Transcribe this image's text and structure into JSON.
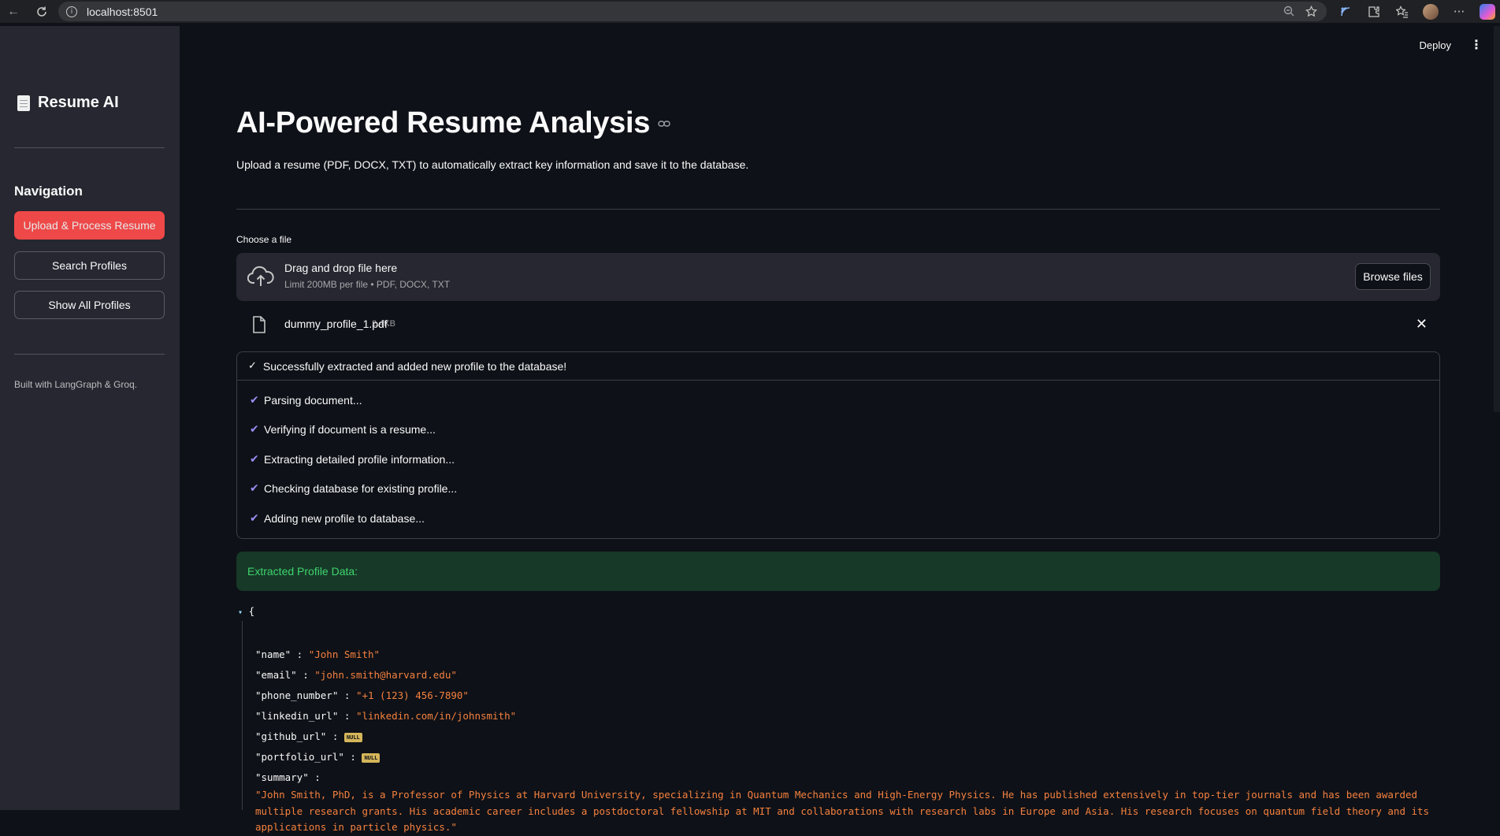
{
  "browser": {
    "url": "localhost:8501"
  },
  "sidebar": {
    "app_title": "Resume AI",
    "nav_heading": "Navigation",
    "buttons": [
      {
        "label": "Upload & Process Resume",
        "active": true
      },
      {
        "label": "Search Profiles",
        "active": false
      },
      {
        "label": "Show All Profiles",
        "active": false
      }
    ],
    "footer": "Built with LangGraph & Groq."
  },
  "header": {
    "deploy_label": "Deploy"
  },
  "main": {
    "title": "AI-Powered Resume Analysis",
    "subtitle": "Upload a resume (PDF, DOCX, TXT) to automatically extract key information and save it to the database.",
    "uploader": {
      "label": "Choose a file",
      "drop_text": "Drag and drop file here",
      "limit_text": "Limit 200MB per file • PDF, DOCX, TXT",
      "browse_label": "Browse files"
    },
    "uploaded_file": {
      "name": "dummy_profile_1.pdf",
      "size": "2.4KB"
    },
    "status": {
      "header": "Successfully extracted and added new profile to the database!",
      "steps": [
        "Parsing document...",
        "Verifying if document is a resume...",
        "Extracting detailed profile information...",
        "Checking database for existing profile...",
        "Adding new profile to database..."
      ]
    },
    "success_message": "Extracted Profile Data:",
    "json": {
      "open_brace": "{",
      "fields": [
        {
          "key": "\"name\"",
          "value": "\"John Smith\"",
          "is_null": false
        },
        {
          "key": "\"email\"",
          "value": "\"john.smith@harvard.edu\"",
          "is_null": false
        },
        {
          "key": "\"phone_number\"",
          "value": "\"+1 (123) 456-7890\"",
          "is_null": false
        },
        {
          "key": "\"linkedin_url\"",
          "value": "\"linkedin.com/in/johnsmith\"",
          "is_null": false
        },
        {
          "key": "\"github_url\"",
          "value": "NULL",
          "is_null": true
        },
        {
          "key": "\"portfolio_url\"",
          "value": "NULL",
          "is_null": true
        }
      ],
      "summary_key": "\"summary\"",
      "summary_value": "\"John Smith, PhD, is a Professor of Physics at Harvard University, specializing in Quantum Mechanics and High-Energy Physics. He has published extensively in top-tier journals and has been awarded multiple research grants. His academic career includes a postdoctoral fellowship at MIT and collaborations with research labs in Europe and Asia. His research focuses on quantum field theory and its applications in particle physics.\""
    }
  },
  "colors": {
    "primary": "#ff4b4b",
    "background": "#0e1117",
    "sidebar": "#262730",
    "success_bg": "#173928",
    "success_text": "#3dd56d",
    "json_string": "#f5813f",
    "step_tick": "#9b8cf2"
  }
}
